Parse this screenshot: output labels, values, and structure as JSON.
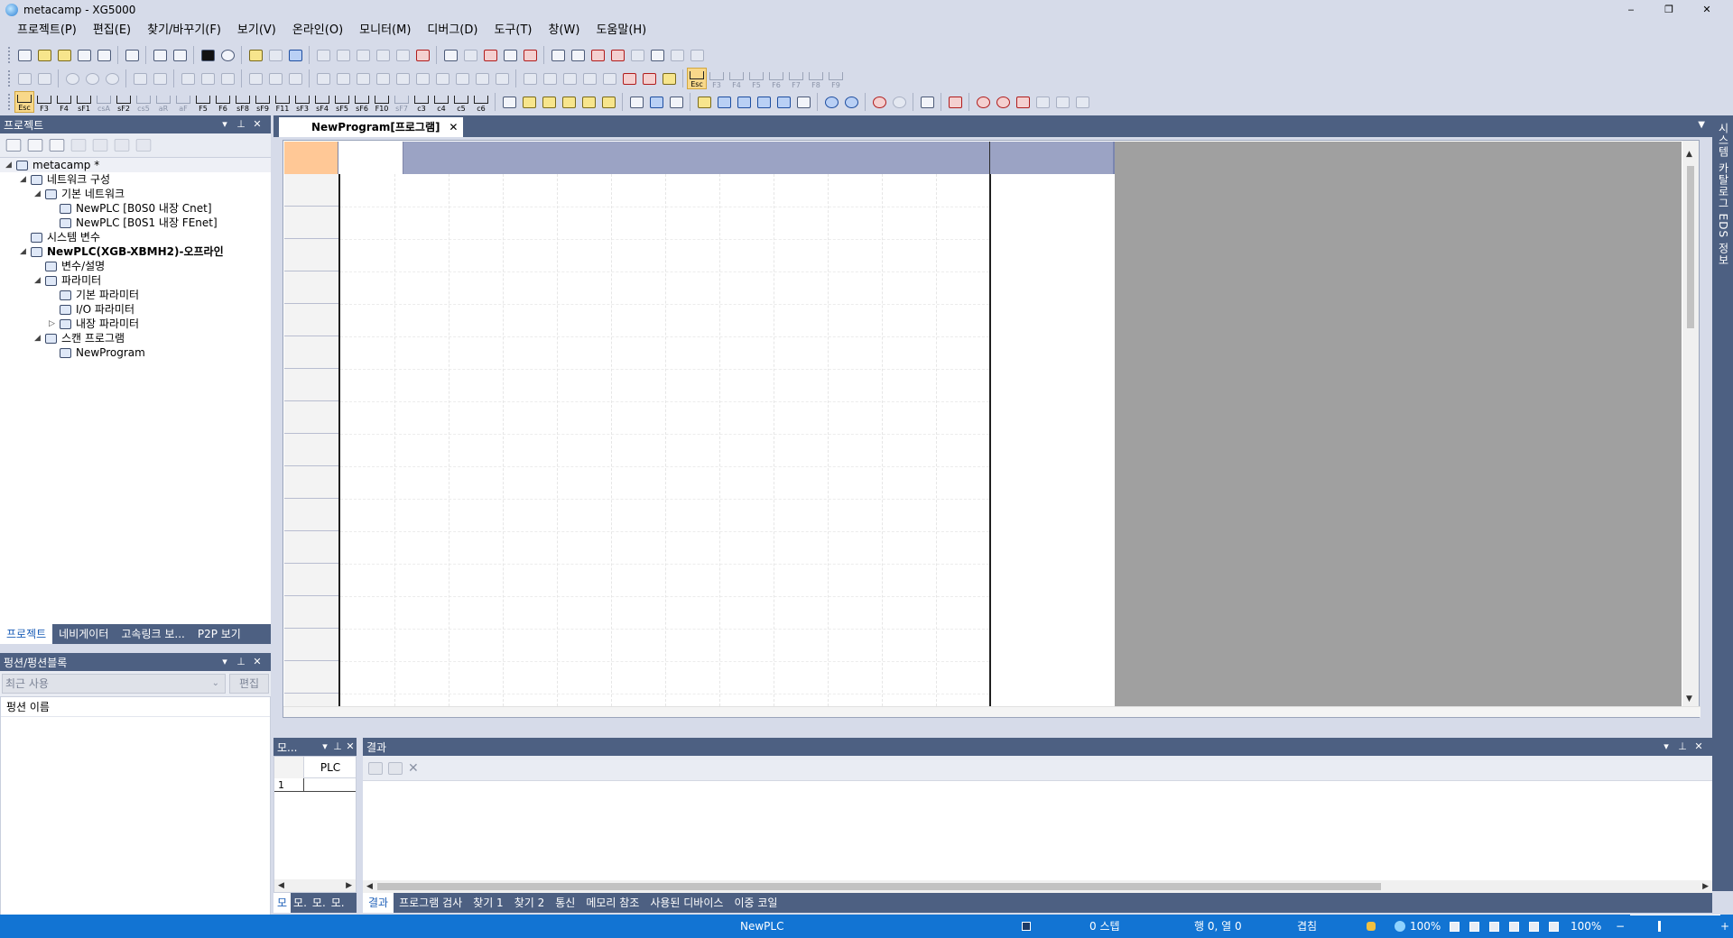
{
  "window": {
    "title": "metacamp - XG5000",
    "min": "‒",
    "restore": "❐",
    "close": "✕"
  },
  "menu": [
    "프로젝트(P)",
    "편집(E)",
    "찾기/바꾸기(F)",
    "보기(V)",
    "온라인(O)",
    "모니터(M)",
    "디버그(D)",
    "도구(T)",
    "창(W)",
    "도움말(H)"
  ],
  "fkeys": {
    "row3": [
      "Esc",
      "F3",
      "F4",
      "sF1",
      "csA",
      "sF2",
      "cs5",
      "aR",
      "aF",
      "F5",
      "F6",
      "sF8",
      "sF9",
      "F11",
      "sF3",
      "sF4",
      "sF5",
      "sF6",
      "F10",
      "sF7",
      "c3",
      "c4",
      "c5",
      "c6"
    ],
    "row2": [
      "Esc",
      "F3",
      "F4",
      "F5",
      "F6",
      "F7",
      "F8",
      "F9"
    ]
  },
  "project_panel": {
    "title": "프로젝트",
    "pin": "⊥",
    "drop": "▾",
    "close": "✕",
    "tree": [
      {
        "label": "metacamp *",
        "level": 0,
        "twist": "◢",
        "bold": false,
        "root": true
      },
      {
        "label": "네트워크 구성",
        "level": 1,
        "twist": "◢",
        "bold": false
      },
      {
        "label": "기본 네트워크",
        "level": 2,
        "twist": "◢",
        "bold": false
      },
      {
        "label": "NewPLC [B0S0 내장 Cnet]",
        "level": 3,
        "twist": "",
        "bold": false
      },
      {
        "label": "NewPLC [B0S1 내장 FEnet]",
        "level": 3,
        "twist": "",
        "bold": false
      },
      {
        "label": "시스템 변수",
        "level": 1,
        "twist": "",
        "bold": false
      },
      {
        "label": "NewPLC(XGB-XBMH2)-오프라인",
        "level": 1,
        "twist": "◢",
        "bold": true
      },
      {
        "label": "변수/설명",
        "level": 2,
        "twist": "",
        "bold": false
      },
      {
        "label": "파라미터",
        "level": 2,
        "twist": "◢",
        "bold": false
      },
      {
        "label": "기본 파라미터",
        "level": 3,
        "twist": "",
        "bold": false
      },
      {
        "label": "I/O 파라미터",
        "level": 3,
        "twist": "",
        "bold": false
      },
      {
        "label": "내장 파라미터",
        "level": 3,
        "twist": "▷",
        "bold": false
      },
      {
        "label": "스캔 프로그램",
        "level": 2,
        "twist": "◢",
        "bold": false
      },
      {
        "label": "NewProgram",
        "level": 3,
        "twist": "",
        "bold": false
      }
    ],
    "tabs": [
      "프로젝트",
      "네비게이터",
      "고속링크 보...",
      "P2P 보기"
    ]
  },
  "function_panel": {
    "title": "펑션/펑션블록",
    "recent": "최근 사용",
    "edit_button": "편집",
    "list_header": "펑션 이름"
  },
  "editor": {
    "tab_title": "NewProgram[프로그램]",
    "tab_close": "✕",
    "rows": 17
  },
  "right_vertical_tab": "시스템 카탈로그 EDS 정보",
  "monitor_panel": {
    "title": "모...",
    "col_header": "PLC",
    "row_number": "1",
    "tabs": [
      "모",
      "모.",
      "모.",
      "모."
    ]
  },
  "results_panel": {
    "title": "결과",
    "tabs": [
      "결과",
      "프로그램 검사",
      "찾기 1",
      "찾기 2",
      "통신",
      "메모리 참조",
      "사용된 디바이스",
      "이중 코일"
    ]
  },
  "status": {
    "plc": "NewPLC",
    "step": "0 스텝",
    "position": "행 0, 열 0",
    "mode": "겹침",
    "zoom_left": "100%",
    "zoom_right": "100%",
    "zoom_minus": "−",
    "zoom_plus": "+"
  },
  "colors": {
    "chrome": "#d6dbe9",
    "panel_header": "#4d6082",
    "statusbar": "#1274d3",
    "ladder_header": "#9ba3c4",
    "corner_cell": "#ffc896",
    "gray_area": "#a0a0a0"
  }
}
